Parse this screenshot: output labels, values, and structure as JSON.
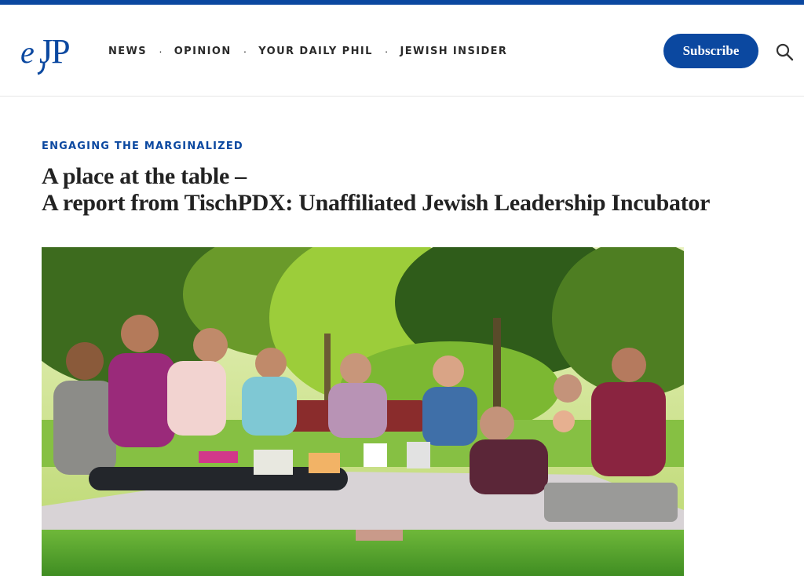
{
  "brand": {
    "logo_text": "eJP",
    "accent_color": "#0b48a0"
  },
  "nav": {
    "items": [
      {
        "label": "NEWS"
      },
      {
        "label": "OPINION"
      },
      {
        "label": "YOUR DAILY PHIL"
      },
      {
        "label": "JEWISH INSIDER"
      }
    ],
    "separator": "·"
  },
  "header": {
    "subscribe_label": "Subscribe",
    "search_icon": "search-icon"
  },
  "article": {
    "kicker": "ENGAGING THE MARGINALIZED",
    "title_line1": "A place at the table –",
    "title_line2": "A report from TischPDX: Unaffiliated Jewish Leadership Incubator"
  }
}
